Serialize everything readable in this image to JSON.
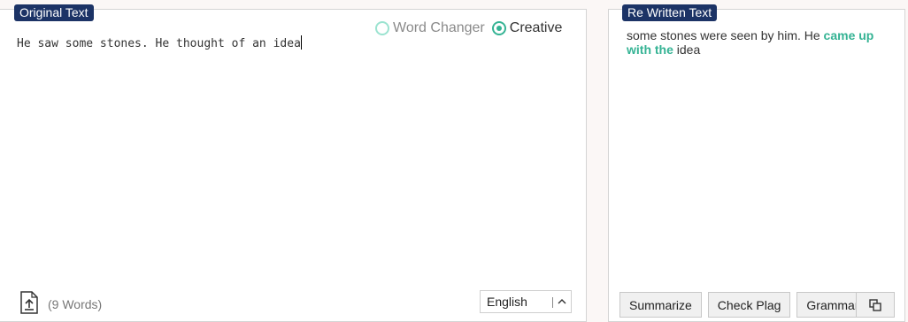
{
  "original_panel": {
    "label": "Original Text",
    "modes": [
      {
        "label": "Word Changer",
        "checked": false
      },
      {
        "label": "Creative",
        "checked": true
      }
    ],
    "input_text": "He saw some stones. He thought of an idea",
    "word_count": "(9 Words)",
    "language": "English"
  },
  "rewritten_panel": {
    "label": "Re Written Text",
    "output_before": "some stones were seen by him. He ",
    "output_highlight": "came up with the",
    "output_after": " idea",
    "buttons": {
      "summarize": "Summarize",
      "check_plag": "Check Plag",
      "grammar": "Grammar"
    }
  },
  "colors": {
    "label_bg": "#1c3366",
    "accent": "#35b394",
    "accent_light": "#9be3d0"
  },
  "icons": [
    "upload-icon",
    "chevron-up-icon",
    "copy-icon"
  ]
}
